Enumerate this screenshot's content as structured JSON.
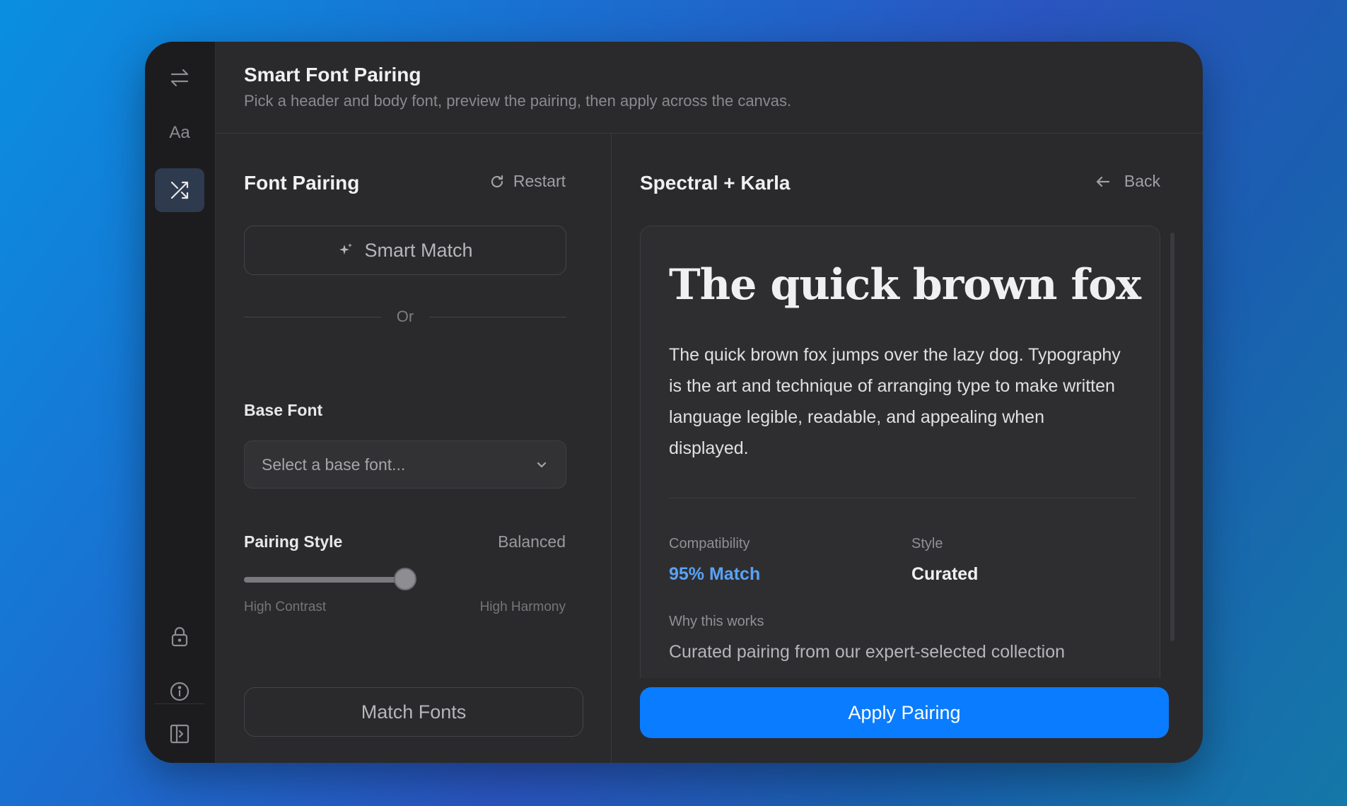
{
  "header": {
    "title": "Smart Font Pairing",
    "subtitle": "Pick a header and body font, preview the pairing, then apply across the canvas."
  },
  "rail": {
    "items": [
      {
        "name": "swap-icon"
      },
      {
        "name": "typography-icon",
        "text": "Aa"
      },
      {
        "name": "shuffle-icon"
      },
      {
        "name": "lock-icon"
      },
      {
        "name": "info-icon"
      },
      {
        "name": "sidebar-panel-icon"
      }
    ],
    "active": "shuffle-icon"
  },
  "left_panel": {
    "title": "Font Pairing",
    "restart_label": "Restart",
    "smart_match_label": "Smart Match",
    "or_label": "Or",
    "base_font_label": "Base Font",
    "base_font_placeholder": "Select a base font...",
    "pairing_style_label": "Pairing Style",
    "pairing_style_value": "Balanced",
    "slider": {
      "value_fraction": 0.5,
      "min_label": "High Contrast",
      "max_label": "High Harmony"
    },
    "match_fonts_label": "Match Fonts"
  },
  "right_panel": {
    "pair_title": "Spectral + Karla",
    "back_label": "Back",
    "preview": {
      "heading": "The quick brown fox",
      "body": "The quick brown fox jumps over the lazy dog. Typography is the art and technique of arranging type to make written language legible, readable, and appealing when displayed."
    },
    "compatibility_label": "Compatibility",
    "compatibility_value": "95% Match",
    "style_label": "Style",
    "style_value": "Curated",
    "why_label": "Why this works",
    "why_text": "Curated pairing from our expert-selected collection",
    "apply_label": "Apply Pairing"
  },
  "colors": {
    "accent": "#0a7cff",
    "match_text": "#5aa2f5",
    "window_bg": "#2a2a2c",
    "rail_bg": "#1c1c1e"
  }
}
